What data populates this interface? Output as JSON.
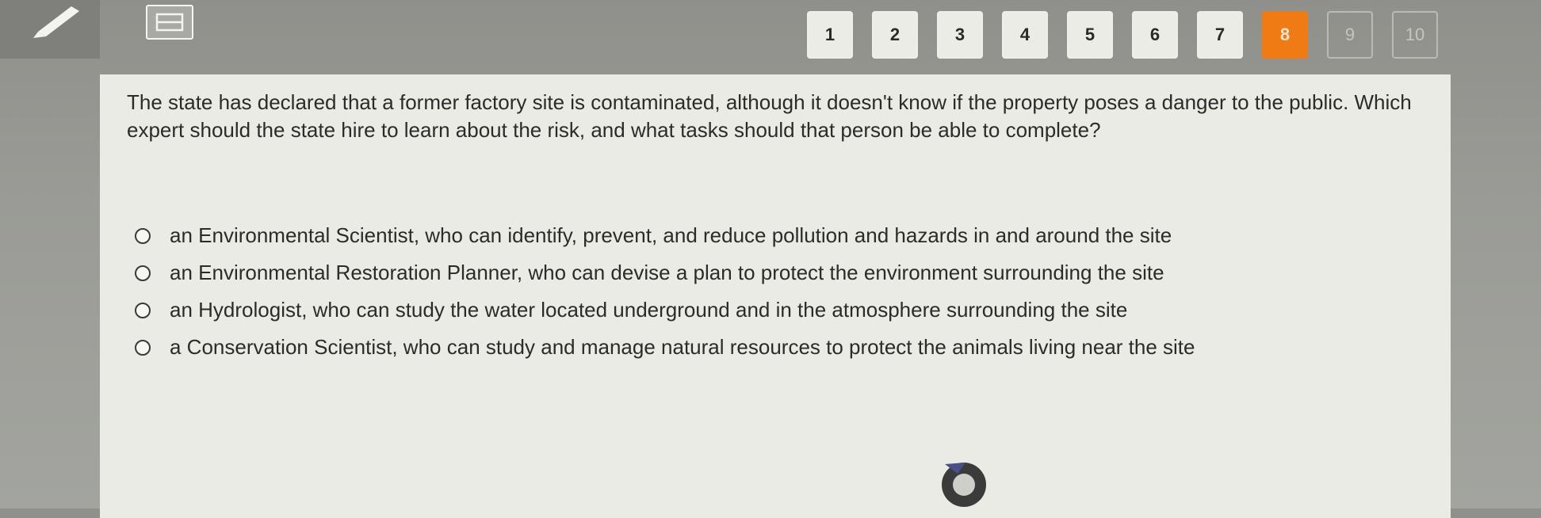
{
  "toolbar": {
    "tools": [
      "pencil-icon",
      "eraser-icon"
    ]
  },
  "pager": {
    "pages": [
      "1",
      "2",
      "3",
      "4",
      "5",
      "6",
      "7",
      "8",
      "9",
      "10"
    ],
    "current": "8",
    "colors": {
      "current": "#f07a14"
    }
  },
  "question": {
    "text": "The state has declared that a former factory site is contaminated, although it doesn't know if the property poses a danger to the public. Which expert should the state hire to learn about the risk, and what tasks should that person be able to complete?"
  },
  "choices": [
    "an Environmental Scientist, who can identify, prevent, and reduce pollution and hazards in and around the site",
    "an Environmental Restoration Planner, who can devise a plan to protect the environment surrounding the site",
    "an Hydrologist, who can study the water located underground and in the atmosphere surrounding the site",
    "a Conservation Scientist, who can study and manage natural resources to protect the animals living near the site"
  ],
  "audio": {
    "icon": "listen-icon"
  }
}
